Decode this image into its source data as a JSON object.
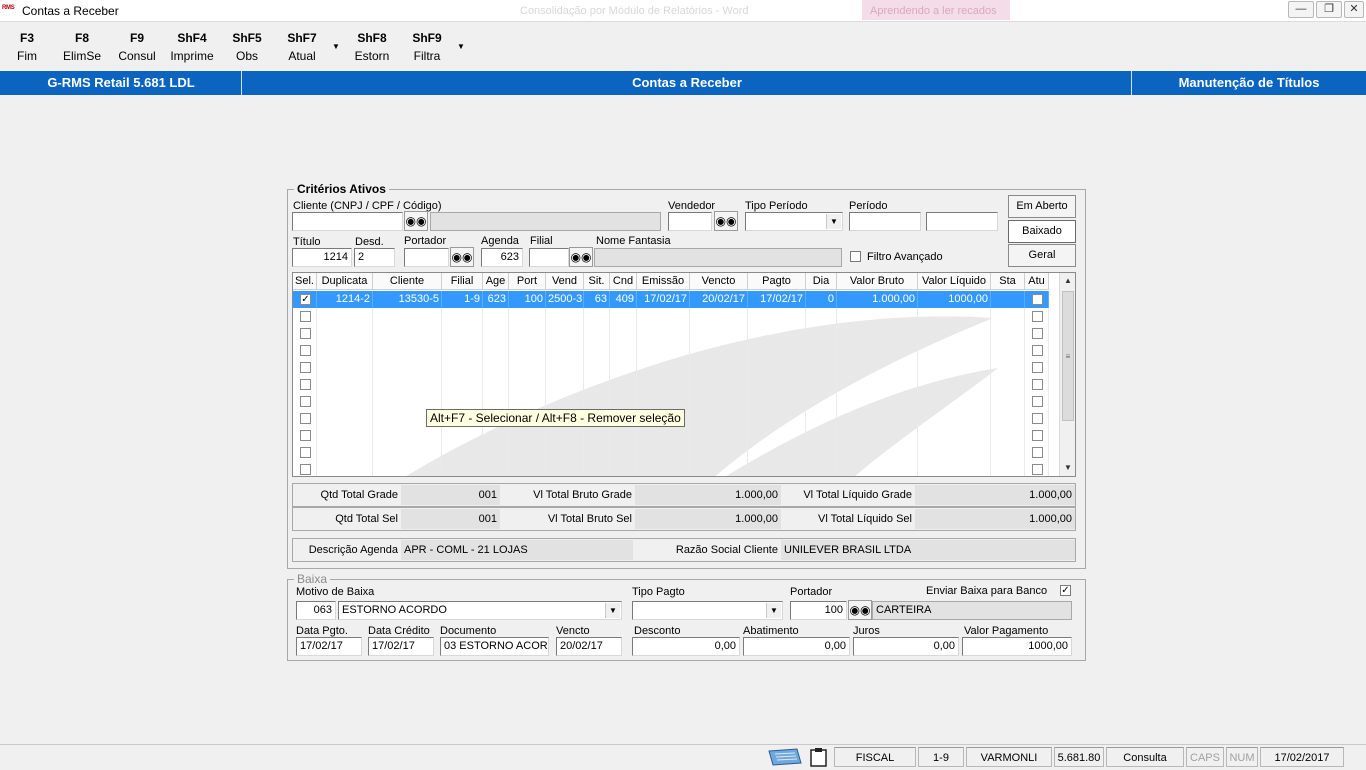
{
  "window": {
    "logo_text": "RMS",
    "title": "Contas a Receber",
    "ghost_title": "Consolidação por Módulo de Relatórios - Word",
    "ghost_tab": "Aprendendo a ler recados",
    "min_icon": "minimize-icon",
    "restore_icon": "restore-icon",
    "close_icon": "close-icon"
  },
  "toolbar": {
    "buttons": [
      {
        "key": "F3",
        "label": "Fim"
      },
      {
        "key": "F8",
        "label": "ElimSe"
      },
      {
        "key": "F9",
        "label": "Consul"
      },
      {
        "key": "ShF4",
        "label": "Imprime"
      },
      {
        "key": "ShF5",
        "label": "Obs"
      },
      {
        "key": "ShF7",
        "label": "Atual"
      },
      {
        "key": "ShF8",
        "label": "Estorn"
      },
      {
        "key": "ShF9",
        "label": "Filtra"
      }
    ]
  },
  "band": {
    "app": "G-RMS Retail 5.681 LDL",
    "module": "Contas a Receber",
    "screen": "Manutenção de Títulos"
  },
  "criteria": {
    "title": "Critérios Ativos",
    "cliente_label": "Cliente (CNPJ / CPF / Código)",
    "cliente_value": "",
    "cliente_nome": "",
    "vendedor_label": "Vendedor",
    "vendedor_value": "",
    "tipo_periodo_label": "Tipo Período",
    "tipo_periodo_value": "",
    "periodo_label": "Período",
    "periodo_inicio": "",
    "periodo_fim": "",
    "titulo_label": "Título",
    "titulo_value": "1214",
    "desd_label": "Desd.",
    "desd_value": "2",
    "portador_label": "Portador",
    "portador_value": "",
    "agenda_label": "Agenda",
    "agenda_value": "623",
    "filial_label": "Filial",
    "filial_value": "",
    "nome_fantasia_label": "Nome Fantasia",
    "nome_fantasia_value": "",
    "filtro_avancado_label": "Filtro Avançado",
    "btn_em_aberto": "Em Aberto",
    "btn_baixado": "Baixado",
    "btn_geral": "Geral"
  },
  "grid": {
    "columns": [
      "Sel.",
      "Duplicata",
      "Cliente",
      "Filial",
      "Age",
      "Port",
      "Vend",
      "Sit.",
      "Cnd",
      "Emissão",
      "Vencto",
      "Pagto",
      "Dia",
      "Valor Bruto",
      "Valor Líquido",
      "Sta",
      "Atu"
    ],
    "rows": [
      {
        "sel": true,
        "duplicata": "1214-2",
        "cliente": "13530-5",
        "filial": "1-9",
        "age": "623",
        "port": "100",
        "vend": "2500-3",
        "sit": "63",
        "cnd": "409",
        "emissao": "17/02/17",
        "vencto": "20/02/17",
        "pagto": "17/02/17",
        "dia": "0",
        "valor_bruto": "1.000,00",
        "valor_liquido": "1000,00",
        "sta": "",
        "atu": false
      }
    ],
    "empty_rows": 10,
    "tooltip": "Alt+F7 - Selecionar / Alt+F8 - Remover seleção"
  },
  "totals": {
    "qtd_total_grade_label": "Qtd Total Grade",
    "qtd_total_grade": "001",
    "vl_total_bruto_grade_label": "Vl Total Bruto Grade",
    "vl_total_bruto_grade": "1.000,00",
    "vl_total_liquido_grade_label": "Vl Total Líquido Grade",
    "vl_total_liquido_grade": "1.000,00",
    "qtd_total_sel_label": "Qtd Total Sel",
    "qtd_total_sel": "001",
    "vl_total_bruto_sel_label": "Vl Total Bruto Sel",
    "vl_total_bruto_sel": "1.000,00",
    "vl_total_liquido_sel_label": "Vl Total Líquido Sel",
    "vl_total_liquido_sel": "1.000,00",
    "descricao_agenda_label": "Descrição Agenda",
    "descricao_agenda": "APR - COML - 21 LOJAS",
    "razao_social_label": "Razão Social Cliente",
    "razao_social": "UNILEVER BRASIL LTDA"
  },
  "baixa": {
    "title": "Baixa",
    "motivo_label": "Motivo de Baixa",
    "motivo_codigo": "063",
    "motivo_descricao": "ESTORNO ACORDO",
    "tipo_pagto_label": "Tipo Pagto",
    "tipo_pagto_value": "",
    "portador_label": "Portador",
    "portador_codigo": "100",
    "portador_nome": "CARTEIRA",
    "enviar_banco_label": "Enviar Baixa para Banco",
    "enviar_banco_checked": true,
    "data_pgto_label": "Data Pgto.",
    "data_pgto": "17/02/17",
    "data_credito_label": "Data Crédito",
    "data_credito": "17/02/17",
    "documento_label": "Documento",
    "documento": "03 ESTORNO ACOR",
    "vencto_label": "Vencto",
    "vencto": "20/02/17",
    "desconto_label": "Desconto",
    "desconto": "0,00",
    "abatimento_label": "Abatimento",
    "abatimento": "0,00",
    "juros_label": "Juros",
    "juros": "0,00",
    "valor_pagamento_label": "Valor Pagamento",
    "valor_pagamento": "1000,00"
  },
  "statusbar": {
    "icons": [
      "keyboard-icon",
      "clipboard-icon"
    ],
    "cells": [
      "FISCAL",
      "1-9",
      "VARMONLI",
      "5.681.80",
      "Consulta",
      "CAPS",
      "NUM",
      "17/02/2017"
    ]
  },
  "colors": {
    "band": "#0a64c0",
    "selection": "#3399ff"
  }
}
